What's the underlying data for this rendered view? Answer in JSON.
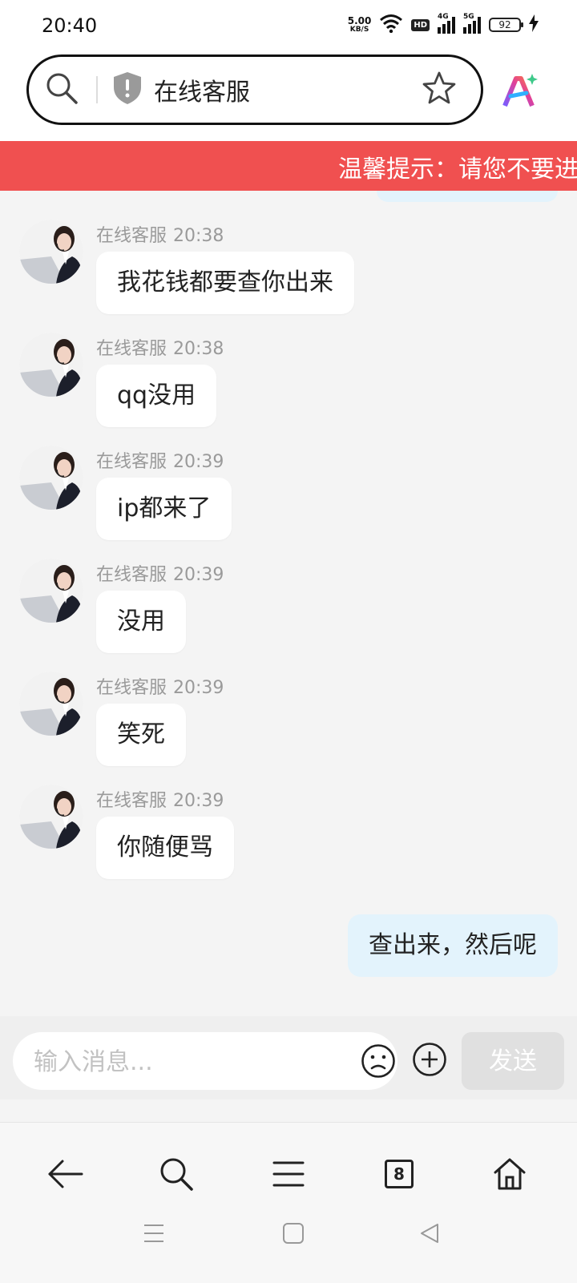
{
  "status_bar": {
    "time": "20:40",
    "net_speed": "5.00",
    "net_unit": "KB/S",
    "hd_label": "HD",
    "signal1_label": "4G",
    "signal2_label": "5G",
    "battery": "92"
  },
  "browser": {
    "page_title": "在线客服",
    "icons": [
      "search-icon",
      "shield-icon",
      "star-icon",
      "ai-icon"
    ]
  },
  "notice": {
    "text": "温馨提示：请您不要进"
  },
  "messages": [
    {
      "sender": "在线客服",
      "time": "20:38",
      "text": "我花钱都要查你出来"
    },
    {
      "sender": "在线客服",
      "time": "20:38",
      "text": "qq没用"
    },
    {
      "sender": "在线客服",
      "time": "20:39",
      "text": "ip都来了"
    },
    {
      "sender": "在线客服",
      "time": "20:39",
      "text": "没用"
    },
    {
      "sender": "在线客服",
      "time": "20:39",
      "text": "笑死"
    },
    {
      "sender": "在线客服",
      "time": "20:39",
      "text": "你随便骂"
    }
  ],
  "my_message": {
    "text": "查出来，然后呢"
  },
  "input": {
    "placeholder": "输入消息...",
    "send_label": "发送"
  },
  "bottom_nav": {
    "tab_count": "8",
    "icons": [
      "back-icon",
      "search-icon",
      "menu-icon",
      "tabs-icon",
      "home-icon"
    ]
  },
  "colors": {
    "notice_bg": "#f05050",
    "my_bubble": "#e3f3fc",
    "background": "#f4f4f4"
  }
}
